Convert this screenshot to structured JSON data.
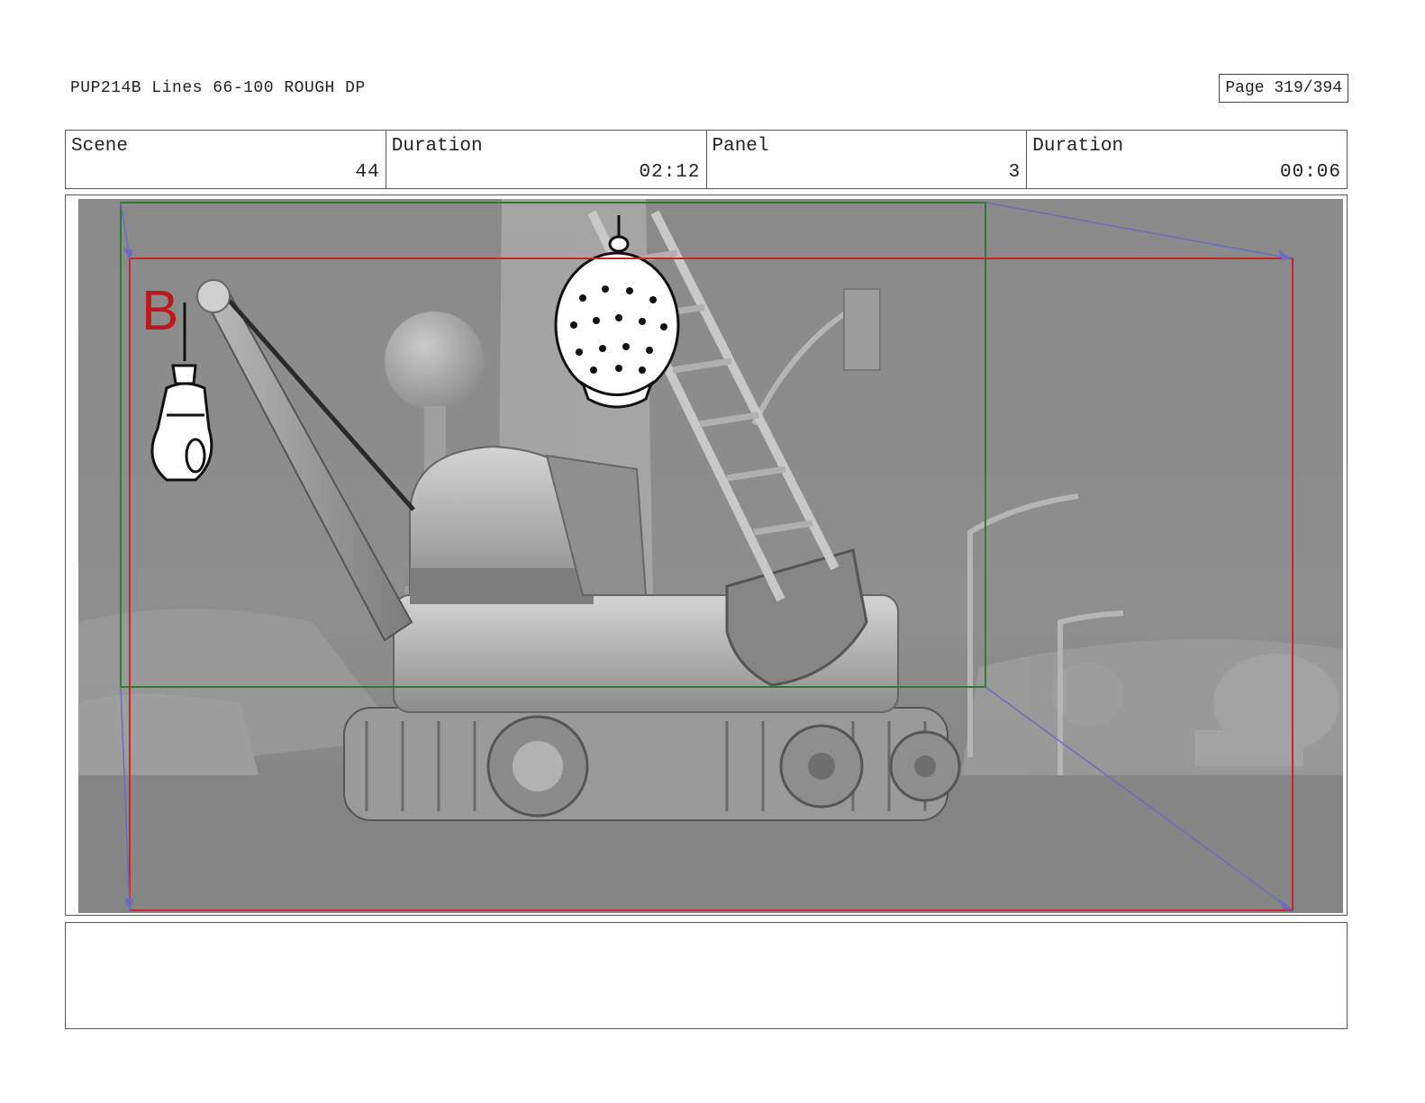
{
  "header": {
    "title": "PUP214B Lines 66-100 ROUGH DP",
    "page": "Page 319/394"
  },
  "info": {
    "scene_label": "Scene",
    "scene_value": "44",
    "duration_label": "Duration",
    "duration_value": "02:12",
    "panel_label": "Panel",
    "panel_value": "3",
    "panel_duration_label": "Duration",
    "panel_duration_value": "00:06"
  },
  "panel": {
    "field_mark": "B",
    "colors": {
      "start_frame": "#2e7d32",
      "end_frame": "#c62828",
      "camera_move": "#6b6bbf",
      "field_mark": "#c0171c"
    }
  },
  "notes": {
    "text": ""
  }
}
